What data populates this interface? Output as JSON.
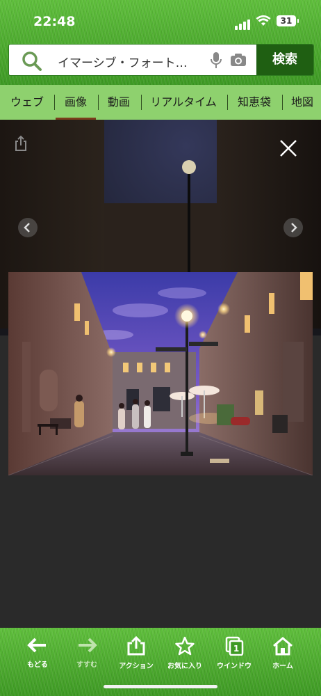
{
  "status": {
    "time": "22:48",
    "battery": "31"
  },
  "search": {
    "value": "イマーシブ・フォート…",
    "button_label": "検索"
  },
  "tabs": [
    {
      "label": "ウェブ"
    },
    {
      "label": "画像"
    },
    {
      "label": "動画"
    },
    {
      "label": "リアルタイム"
    },
    {
      "label": "知恵袋"
    },
    {
      "label": "地図"
    }
  ],
  "active_tab": "画像",
  "bottom_nav": [
    {
      "label": "もどる",
      "icon": "back-arrow-icon"
    },
    {
      "label": "すすむ",
      "icon": "forward-arrow-icon"
    },
    {
      "label": "アクション",
      "icon": "share-icon"
    },
    {
      "label": "お気に入り",
      "icon": "star-icon"
    },
    {
      "label": "ウインドウ",
      "icon": "window-icon",
      "badge": "1"
    },
    {
      "label": "ホーム",
      "icon": "home-icon"
    }
  ],
  "colors": {
    "accent_green": "#1f5f12",
    "tab_bg": "#8ed16e",
    "active_tab_underline": "#7a3d1c"
  }
}
